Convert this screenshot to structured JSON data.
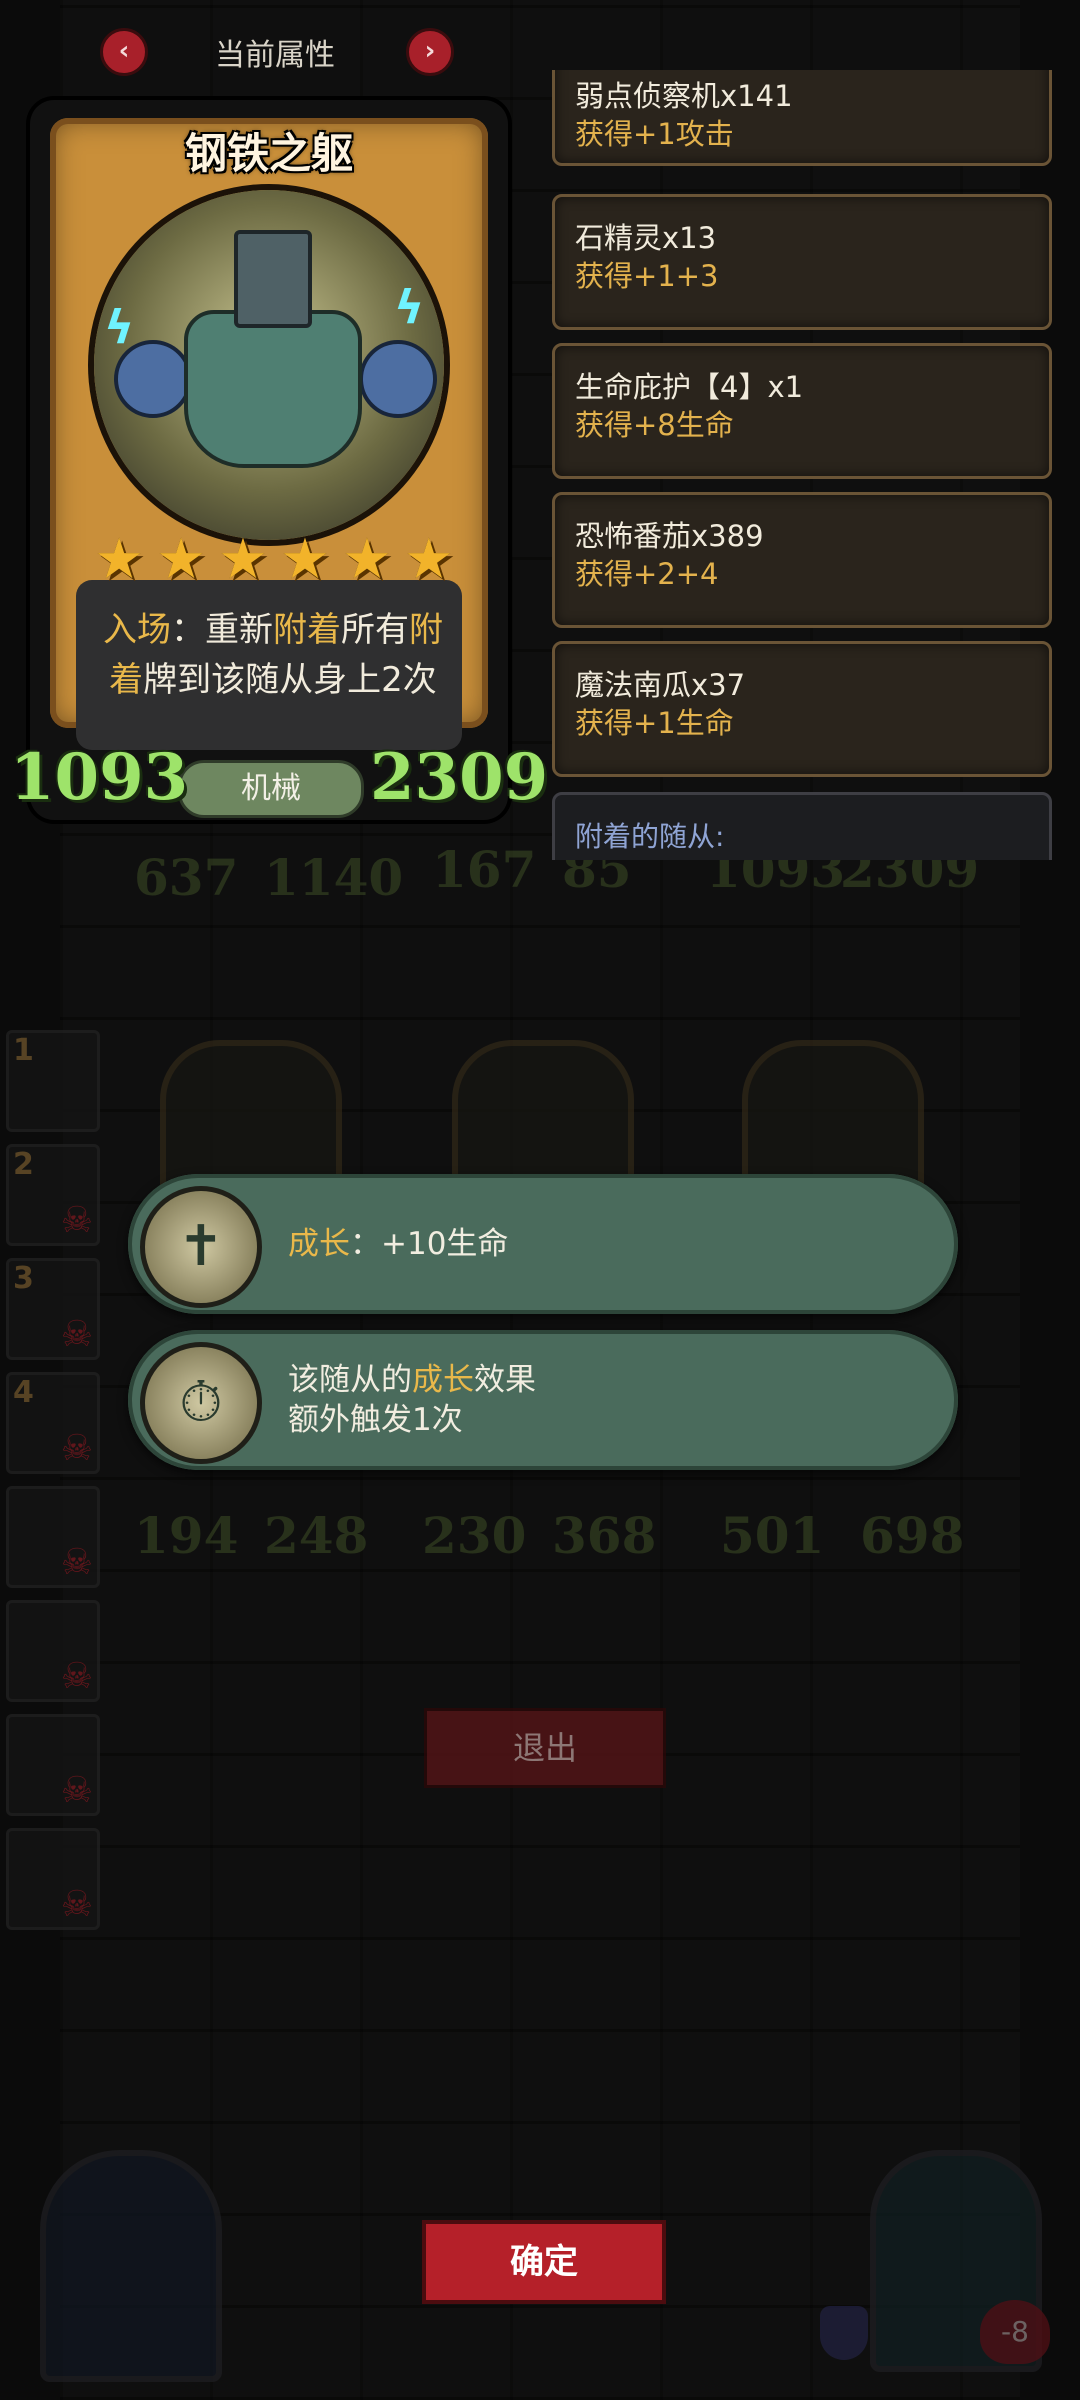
{
  "header": {
    "title": "当前属性",
    "prev_icon": "‹",
    "next_icon": "›"
  },
  "card": {
    "name": "钢铁之躯",
    "stars": 6,
    "desc_parts": [
      "入场",
      "：重新",
      "附着",
      "所有",
      "附着",
      "牌到该随从身上2次"
    ],
    "attack": "1093",
    "health": "2309",
    "type": "机械"
  },
  "effects_list": [
    {
      "title": "弱点侦察机x141",
      "gain": "获得+1攻击"
    },
    {
      "title": "石精灵x13",
      "gain": "获得+1+3"
    },
    {
      "title": "生命庇护【4】x1",
      "gain": "获得+8生命"
    },
    {
      "title": "恐怖番茄x389",
      "gain": "获得+2+4"
    },
    {
      "title": "魔法南瓜x37",
      "gain": "获得+1生命"
    }
  ],
  "attached_label": "附着的随从:",
  "board_top_stats": [
    "637",
    "1140",
    "167",
    "85",
    "1093",
    "2309"
  ],
  "board_bottom_stats": [
    "194",
    "248",
    "230",
    "368",
    "501",
    "698"
  ],
  "slots": [
    "1",
    "2",
    "3",
    "4",
    "",
    "",
    "",
    ""
  ],
  "banners": [
    {
      "icon": "cross-icon",
      "hl": "成长",
      "text": "：+10生命"
    },
    {
      "icon": "stopwatch-icon",
      "pre": "该随从的",
      "hl": "成长",
      "post": "效果",
      "line2": "额外触发1次"
    }
  ],
  "buttons": {
    "exit": "退出",
    "confirm": "确定"
  },
  "hud": {
    "player_health": "-8"
  },
  "colors": {
    "highlight": "#e9b84a",
    "stat_green": "#9ee36a",
    "button_red": "#b52029",
    "banner_green": "#4a6b5c"
  }
}
